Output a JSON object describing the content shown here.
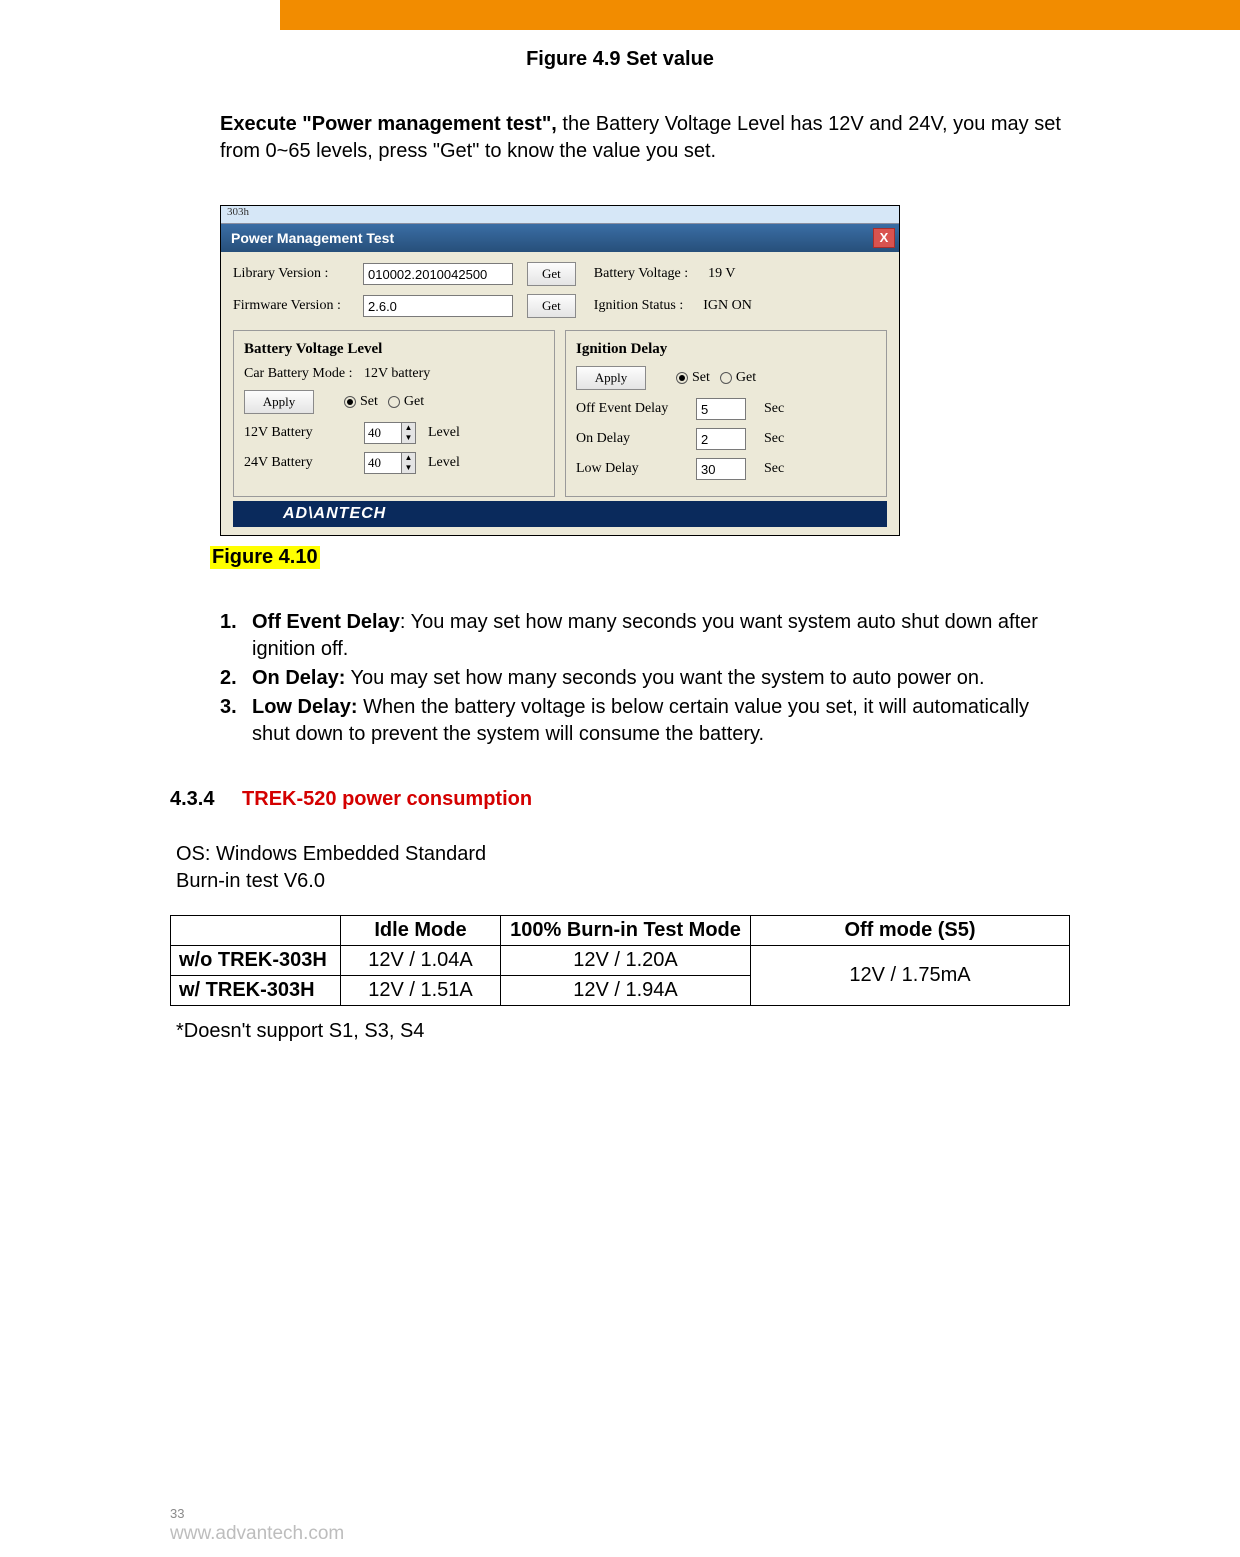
{
  "header": {
    "figure_top": "Figure 4.9 Set value"
  },
  "intro": {
    "bold_lead": "Execute \"Power management test\",",
    "rest": " the Battery Voltage Level has 12V and 24V, you may set from 0~65 levels, press \"Get\" to know the value you set."
  },
  "screenshot": {
    "window_small_title": "303h",
    "title": "Power Management Test",
    "close": "X",
    "library_version_label": "Library Version :",
    "library_version_value": "010002.2010042500",
    "firmware_version_label": "Firmware Version :",
    "firmware_version_value": "2.6.0",
    "get_button": "Get",
    "battery_voltage_label": "Battery Voltage :",
    "battery_voltage_value": "19 V",
    "ignition_status_label": "Ignition Status :",
    "ignition_status_value": "IGN ON",
    "bvl": {
      "title": "Battery Voltage Level",
      "car_mode_label": "Car Battery Mode :",
      "car_mode_value": "12V battery",
      "apply": "Apply",
      "set": "Set",
      "get": "Get",
      "v12_label": "12V Battery",
      "v12_value": "40",
      "v24_label": "24V Battery",
      "v24_value": "40",
      "level": "Level"
    },
    "ign": {
      "title": "Ignition Delay",
      "apply": "Apply",
      "set": "Set",
      "get": "Get",
      "off_event_label": "Off Event Delay",
      "off_event_value": "5",
      "on_delay_label": "On Delay",
      "on_delay_value": "2",
      "low_delay_label": "Low Delay",
      "low_delay_value": "30",
      "sec": "Sec"
    },
    "adv_logo_text": "AD\\ANTECH"
  },
  "fig_caption_yellow": "Figure 4.10",
  "list": [
    {
      "num": "1.",
      "bold": "Off Event Delay",
      "rest": ": You may set how many seconds you want system auto shut down after ignition off."
    },
    {
      "num": "2.",
      "bold": "On Delay:",
      "rest": " You may set how many seconds you want the system to auto power on."
    },
    {
      "num": "3.",
      "bold": "Low Delay:",
      "rest": " When the battery voltage is below certain value you set, it will automatically shut down to prevent the system will consume the battery."
    }
  ],
  "section": {
    "num": "4.3.4",
    "title": "TREK-520 power consumption"
  },
  "table_intro_1": "OS: Windows Embedded Standard",
  "table_intro_2": "Burn-in test V6.0",
  "table": {
    "headers": [
      "",
      "Idle Mode",
      "100% Burn-in Test Mode",
      "Off mode (S5)"
    ],
    "rows": [
      {
        "label": "w/o TREK-303H",
        "idle": "12V / 1.04A",
        "burn": "12V / 1.20A"
      },
      {
        "label": "w/ TREK-303H",
        "idle": "12V / 1.51A",
        "burn": "12V / 1.94A"
      }
    ],
    "off_mode": "12V / 1.75mA"
  },
  "table_note": "*Doesn't support S1, S3, S4",
  "footer": {
    "page": "33",
    "url": "www.advantech.com"
  }
}
